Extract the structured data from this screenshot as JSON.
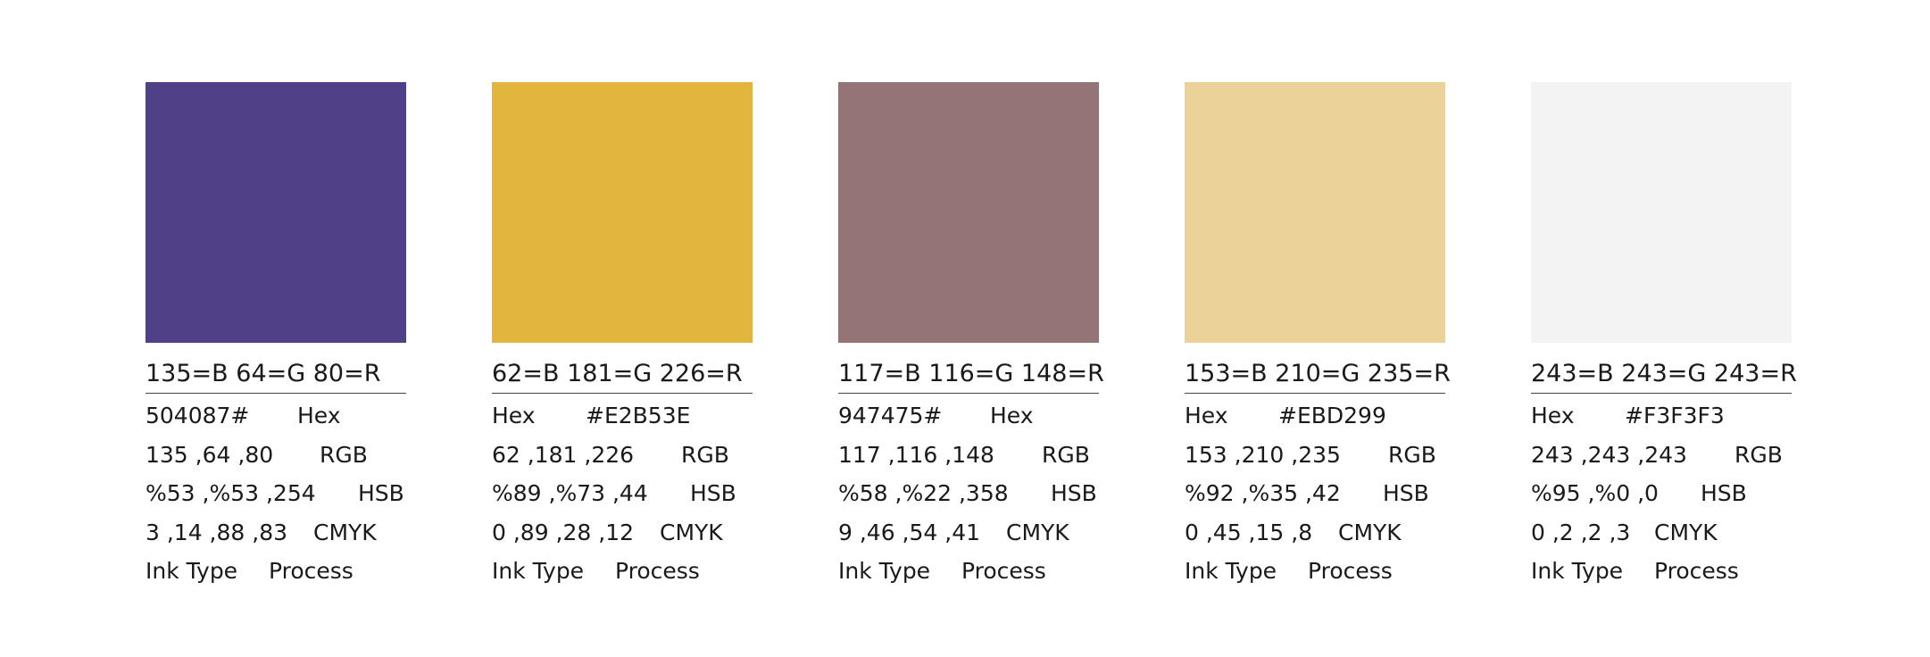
{
  "colors": [
    {
      "swatch": "#504087",
      "rgb_title": "135=B 64=G 80=R",
      "hex_value": "504087#",
      "hex_label": "Hex",
      "rgb_value": "135 ,64 ,80",
      "rgb_label": "RGB",
      "hsb_value": "%53 ,%53 ,254",
      "hsb_label": "HSB",
      "cmyk_value": "3 ,14 ,88 ,83",
      "cmyk_label": "CMYK",
      "ink_label": "Ink Type",
      "ink_value": "Process"
    },
    {
      "swatch": "#E2B53E",
      "rgb_title": "62=B 181=G 226=R",
      "hex_label": "Hex",
      "hex_value": "#E2B53E",
      "rgb_value": "62 ,181 ,226",
      "rgb_label": "RGB",
      "hsb_value": "%89 ,%73 ,44",
      "hsb_label": "HSB",
      "cmyk_value": "0 ,89 ,28 ,12",
      "cmyk_label": "CMYK",
      "ink_label": "Ink Type",
      "ink_value": "Process"
    },
    {
      "swatch": "#947475",
      "rgb_title": "117=B 116=G 148=R",
      "hex_value": "947475#",
      "hex_label": "Hex",
      "rgb_value": "117 ,116 ,148",
      "rgb_label": "RGB",
      "hsb_value": "%58 ,%22 ,358",
      "hsb_label": "HSB",
      "cmyk_value": "9 ,46 ,54 ,41",
      "cmyk_label": "CMYK",
      "ink_label": "Ink Type",
      "ink_value": "Process"
    },
    {
      "swatch": "#EBD299",
      "rgb_title": "153=B 210=G 235=R",
      "hex_label": "Hex",
      "hex_value": "#EBD299",
      "rgb_value": "153 ,210 ,235",
      "rgb_label": "RGB",
      "hsb_value": "%92 ,%35 ,42",
      "hsb_label": "HSB",
      "cmyk_value": "0 ,45 ,15 ,8",
      "cmyk_label": "CMYK",
      "ink_label": "Ink Type",
      "ink_value": "Process"
    },
    {
      "swatch": "#F3F3F3",
      "rgb_title": "243=B 243=G 243=R",
      "hex_label": "Hex",
      "hex_value": "#F3F3F3",
      "rgb_value": "243 ,243 ,243",
      "rgb_label": "RGB",
      "hsb_value": "%95 ,%0 ,0",
      "hsb_label": "HSB",
      "cmyk_value": "0 ,2 ,2 ,3",
      "cmyk_label": "CMYK",
      "ink_label": "Ink Type",
      "ink_value": "Process"
    }
  ]
}
